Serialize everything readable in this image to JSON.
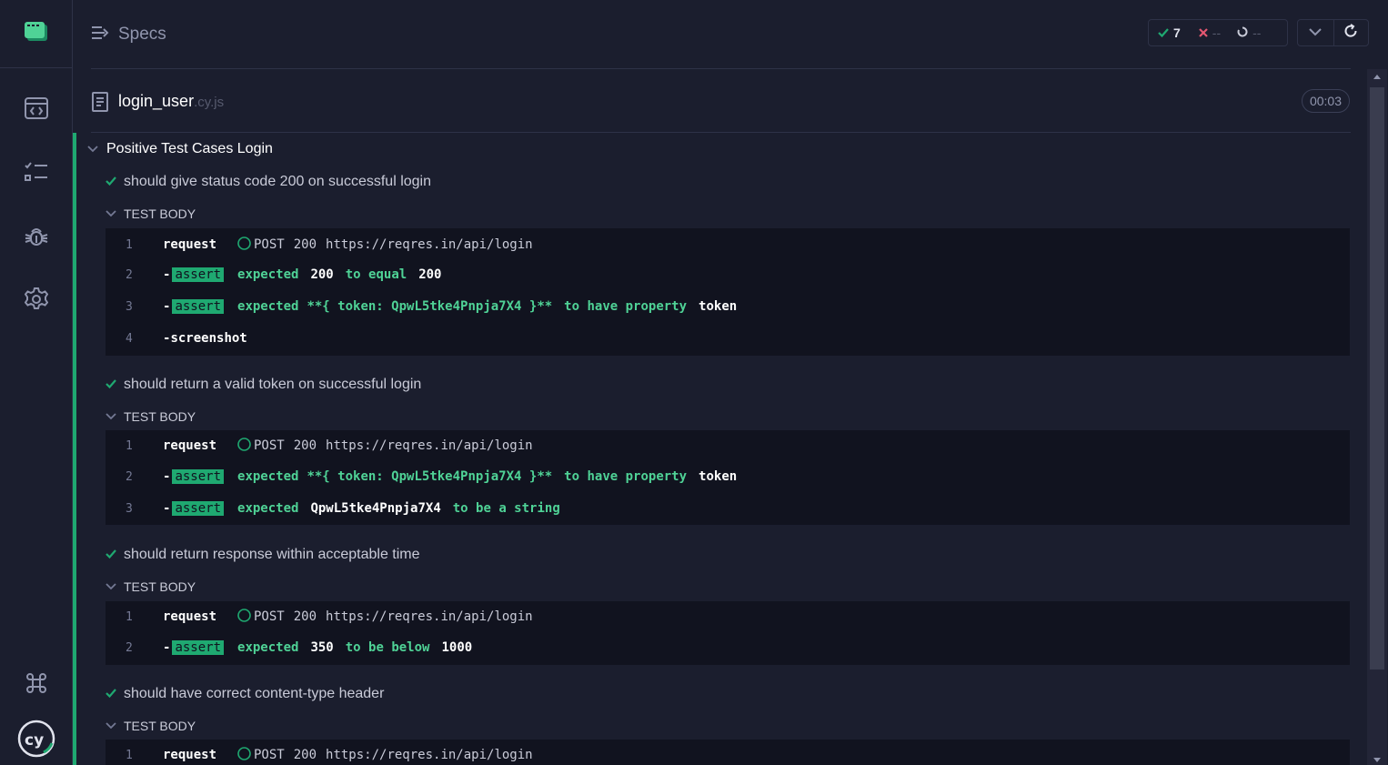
{
  "header": {
    "specs_label": "Specs",
    "passed_count": "7",
    "failed_count": "--",
    "pending_count": "--"
  },
  "spec": {
    "name": "login_user",
    "ext": ".cy.js",
    "duration": "00:03"
  },
  "suite": {
    "title": "Positive Test Cases Login"
  },
  "tests": [
    {
      "title": "should give status code 200 on successful login",
      "body_label": "TEST BODY",
      "commands": [
        {
          "num": "1",
          "name": "request",
          "method": "POST",
          "status": "200",
          "url": "https://reqres.in/api/login"
        },
        {
          "num": "2",
          "name": "assert",
          "expected": "expected",
          "value1": "200",
          "matcher": "to equal",
          "value2": "200"
        },
        {
          "num": "3",
          "name": "assert",
          "expected": "expected",
          "subject": "**{ token: QpwL5tke4Pnpja7X4 }**",
          "matcher": "to have property",
          "value2": "token"
        },
        {
          "num": "4",
          "name": "screenshot"
        }
      ]
    },
    {
      "title": "should return a valid token on successful login",
      "body_label": "TEST BODY",
      "commands": [
        {
          "num": "1",
          "name": "request",
          "method": "POST",
          "status": "200",
          "url": "https://reqres.in/api/login"
        },
        {
          "num": "2",
          "name": "assert",
          "expected": "expected",
          "subject": "**{ token: QpwL5tke4Pnpja7X4 }**",
          "matcher": "to have property",
          "value2": "token"
        },
        {
          "num": "3",
          "name": "assert",
          "expected": "expected",
          "value1": "QpwL5tke4Pnpja7X4",
          "matcher": "to be a string"
        }
      ]
    },
    {
      "title": "should return response within acceptable time",
      "body_label": "TEST BODY",
      "commands": [
        {
          "num": "1",
          "name": "request",
          "method": "POST",
          "status": "200",
          "url": "https://reqres.in/api/login"
        },
        {
          "num": "2",
          "name": "assert",
          "expected": "expected",
          "value1": "350",
          "matcher": "to be below",
          "value2": "1000"
        }
      ]
    },
    {
      "title": "should have correct content-type header",
      "body_label": "TEST BODY",
      "commands": [
        {
          "num": "1",
          "name": "request",
          "method": "POST",
          "status": "200",
          "url": "https://reqres.in/api/login"
        }
      ]
    }
  ],
  "colors": {
    "pass": "#1fa971",
    "fail": "#e45770",
    "background": "#1b1e2e"
  }
}
